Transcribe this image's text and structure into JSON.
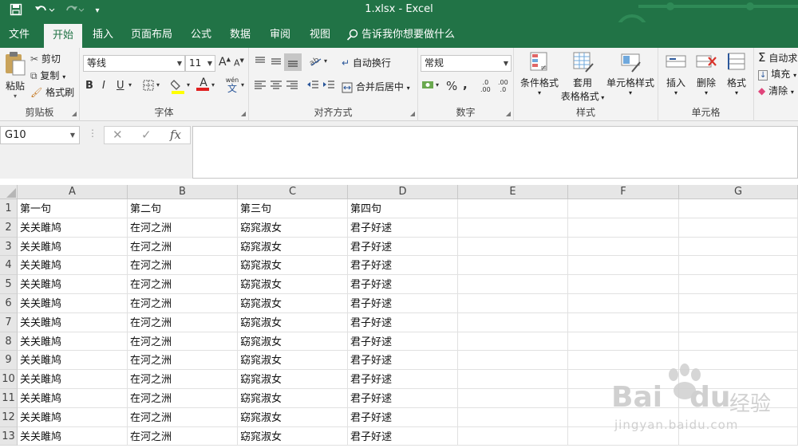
{
  "titlebar": {
    "title": "1.xlsx  -  Excel",
    "save_icon": "save-icon",
    "undo_icon": "undo-icon",
    "redo_icon": "redo-icon",
    "customize_icon": "customize-quick-access-icon",
    "color": "#217346"
  },
  "tabs": [
    {
      "label": "文件"
    },
    {
      "label": "开始"
    },
    {
      "label": "插入"
    },
    {
      "label": "页面布局"
    },
    {
      "label": "公式"
    },
    {
      "label": "数据"
    },
    {
      "label": "审阅"
    },
    {
      "label": "视图"
    }
  ],
  "tell_me": "告诉我你想要做什么",
  "ribbon": {
    "clipboard": {
      "label": "剪贴板",
      "paste": "粘贴",
      "cut": "剪切",
      "copy": "复制",
      "format_painter": "格式刷"
    },
    "font": {
      "label": "字体",
      "font_name": "等线",
      "font_size": "11",
      "bold": "B",
      "italic": "I",
      "underline": "U",
      "phonetic": "wén",
      "phonetic_char": "文",
      "grow": "A",
      "shrink": "A"
    },
    "alignment": {
      "label": "对齐方式",
      "wrap_text": "自动换行",
      "merge_center": "合并后居中"
    },
    "number": {
      "label": "数字",
      "format": "常规",
      "percent": "%",
      "comma": ",",
      "inc_decimal": ".0\n.00",
      "dec_decimal": ".00\n.0"
    },
    "styles": {
      "label": "样式",
      "conditional": "条件格式",
      "table_format_1": "套用",
      "table_format_2": "表格格式",
      "cell_styles": "单元格样式"
    },
    "cells": {
      "label": "单元格",
      "insert": "插入",
      "delete": "删除",
      "format": "格式"
    },
    "editing": {
      "autosum": "自动求",
      "fill": "填充",
      "clear": "清除"
    }
  },
  "formula_bar": {
    "name_box": "G10",
    "cancel": "✕",
    "enter": "✓",
    "fx": "fx",
    "value": ""
  },
  "sheet": {
    "columns": [
      "A",
      "B",
      "C",
      "D",
      "E",
      "F",
      "G"
    ],
    "rows": [
      {
        "num": "1",
        "cells": [
          "第一句",
          "第二句",
          "第三句",
          "第四句",
          "",
          "",
          ""
        ]
      },
      {
        "num": "2",
        "cells": [
          "关关雎鸠",
          "在河之洲",
          "窈窕淑女",
          "君子好逑",
          "",
          "",
          ""
        ]
      },
      {
        "num": "3",
        "cells": [
          "关关雎鸠",
          "在河之洲",
          "窈窕淑女",
          "君子好逑",
          "",
          "",
          ""
        ]
      },
      {
        "num": "4",
        "cells": [
          "关关雎鸠",
          "在河之洲",
          "窈窕淑女",
          "君子好逑",
          "",
          "",
          ""
        ]
      },
      {
        "num": "5",
        "cells": [
          "关关雎鸠",
          "在河之洲",
          "窈窕淑女",
          "君子好逑",
          "",
          "",
          ""
        ]
      },
      {
        "num": "6",
        "cells": [
          "关关雎鸠",
          "在河之洲",
          "窈窕淑女",
          "君子好逑",
          "",
          "",
          ""
        ]
      },
      {
        "num": "7",
        "cells": [
          "关关雎鸠",
          "在河之洲",
          "窈窕淑女",
          "君子好逑",
          "",
          "",
          ""
        ]
      },
      {
        "num": "8",
        "cells": [
          "关关雎鸠",
          "在河之洲",
          "窈窕淑女",
          "君子好逑",
          "",
          "",
          ""
        ]
      },
      {
        "num": "9",
        "cells": [
          "关关雎鸠",
          "在河之洲",
          "窈窕淑女",
          "君子好逑",
          "",
          "",
          ""
        ]
      },
      {
        "num": "10",
        "cells": [
          "关关雎鸠",
          "在河之洲",
          "窈窕淑女",
          "君子好逑",
          "",
          "",
          ""
        ]
      },
      {
        "num": "11",
        "cells": [
          "关关雎鸠",
          "在河之洲",
          "窈窕淑女",
          "君子好逑",
          "",
          "",
          ""
        ]
      },
      {
        "num": "12",
        "cells": [
          "关关雎鸠",
          "在河之洲",
          "窈窕淑女",
          "君子好逑",
          "",
          "",
          ""
        ]
      },
      {
        "num": "13",
        "cells": [
          "关关雎鸠",
          "在河之洲",
          "窈窕淑女",
          "君子好逑",
          "",
          "",
          ""
        ]
      }
    ]
  },
  "watermark": {
    "brand": "Bai",
    "brand2": "du",
    "cn": "经验",
    "url": "jingyan.baidu.com"
  }
}
